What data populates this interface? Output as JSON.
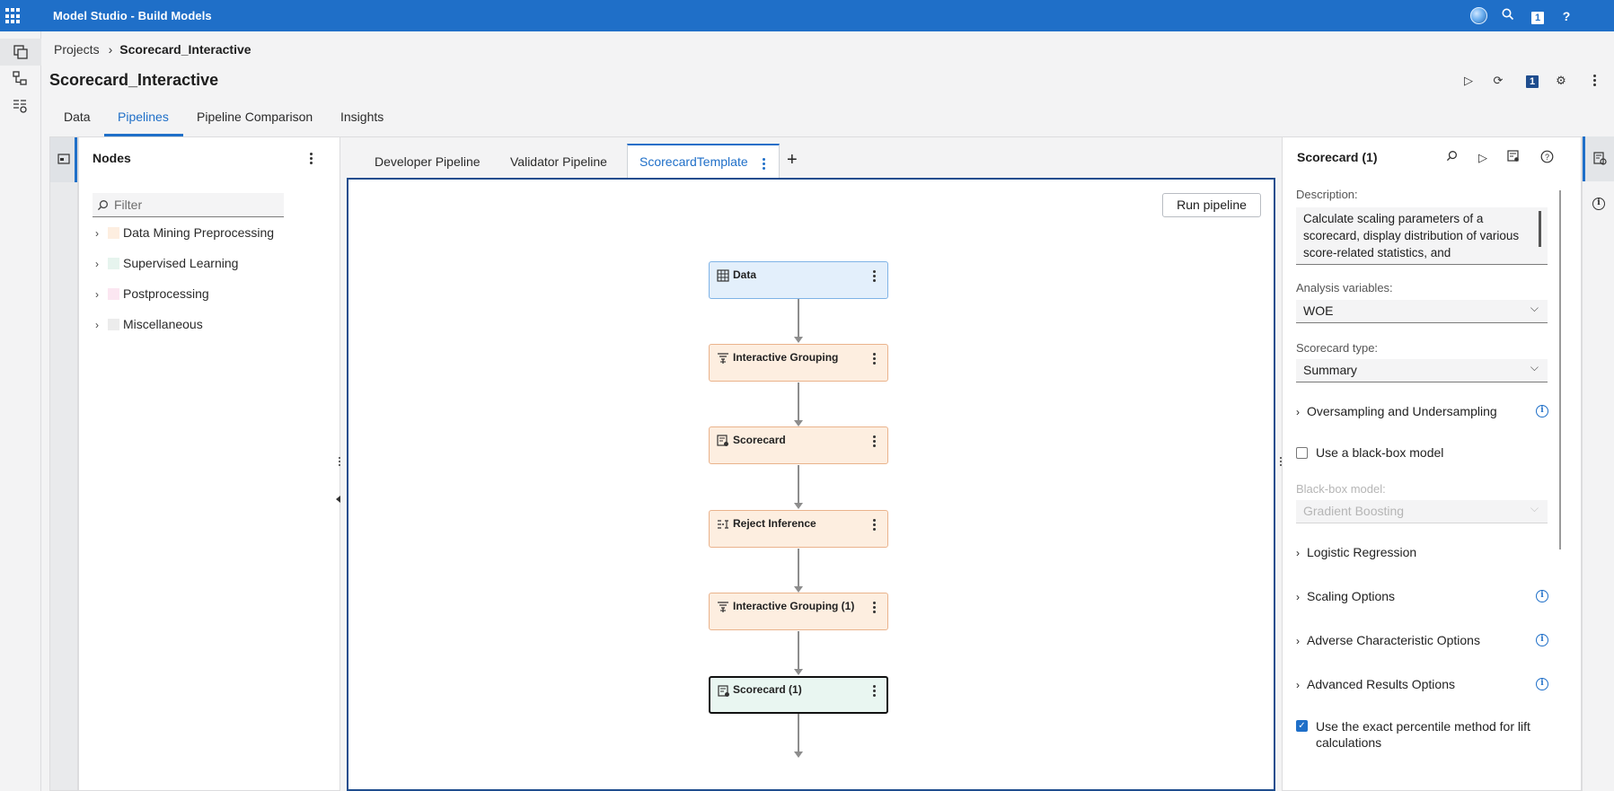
{
  "app": {
    "title": "Model Studio - Build Models",
    "badge_count": "1"
  },
  "breadcrumb": {
    "root": "Projects",
    "separator": "›",
    "current": "Scorecard_Interactive"
  },
  "page": {
    "title": "Scorecard_Interactive",
    "badge_count": "1"
  },
  "main_tabs": [
    {
      "label": "Data",
      "active": false
    },
    {
      "label": "Pipelines",
      "active": true
    },
    {
      "label": "Pipeline Comparison",
      "active": false
    },
    {
      "label": "Insights",
      "active": false
    }
  ],
  "nodes_panel": {
    "title": "Nodes",
    "filter_placeholder": "Filter",
    "categories": [
      {
        "label": "Data Mining Preprocessing",
        "color": "#fdeee0"
      },
      {
        "label": "Supervised Learning",
        "color": "#e6f4ee"
      },
      {
        "label": "Postprocessing",
        "color": "#fbe6f1"
      },
      {
        "label": "Miscellaneous",
        "color": "#ececec"
      }
    ]
  },
  "pipeline_tabs": [
    {
      "label": "Developer Pipeline",
      "active": false
    },
    {
      "label": "Validator Pipeline",
      "active": false
    },
    {
      "label": "ScorecardTemplate",
      "active": true
    }
  ],
  "add_tab": "+",
  "canvas": {
    "run_button": "Run pipeline",
    "nodes": [
      {
        "label": "Data",
        "kind": "data",
        "icon": "data-table-icon"
      },
      {
        "label": "Interactive Grouping",
        "kind": "prep",
        "icon": "grouping-icon"
      },
      {
        "label": "Scorecard",
        "kind": "prep",
        "icon": "scorecard-icon"
      },
      {
        "label": "Reject Inference",
        "kind": "prep",
        "icon": "reject-inference-icon"
      },
      {
        "label": "Interactive Grouping (1)",
        "kind": "prep",
        "icon": "grouping-icon"
      },
      {
        "label": "Scorecard (1)",
        "kind": "post",
        "icon": "scorecard-icon",
        "selected": true
      }
    ]
  },
  "properties": {
    "title": "Scorecard (1)",
    "description_label": "Description:",
    "description": "Calculate scaling parameters of a scorecard, display distribution of various score-related statistics, and",
    "analysis_variables_label": "Analysis variables:",
    "analysis_variables_value": "WOE",
    "scorecard_type_label": "Scorecard type:",
    "scorecard_type_value": "Summary",
    "oversampling_section": "Oversampling and Undersampling",
    "blackbox_checkbox": {
      "label": "Use a black-box model",
      "checked": false
    },
    "blackbox_model_label": "Black-box model:",
    "blackbox_model_value": "Gradient Boosting",
    "logistic_section": "Logistic Regression",
    "scaling_section": "Scaling Options",
    "adverse_section": "Adverse Characteristic Options",
    "advanced_section": "Advanced Results Options",
    "exact_percentile_checkbox": {
      "label_line1": "Use the exact percentile method for lift",
      "label_line2": "calculations",
      "checked": true
    }
  },
  "colors": {
    "brand": "#1f6fc8",
    "data_node": "#e3effb",
    "prep_node": "#fdeee0",
    "post_node": "#e9f6f1"
  }
}
